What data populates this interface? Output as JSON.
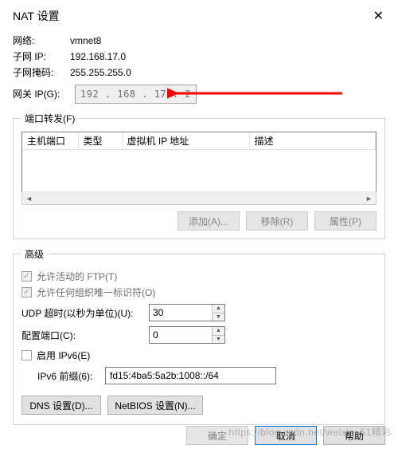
{
  "window": {
    "title": "NAT 设置"
  },
  "network": {
    "network_label": "网络:",
    "network_value": "vmnet8",
    "subnet_ip_label": "子网 IP:",
    "subnet_ip_value": "192.168.17.0",
    "subnet_mask_label": "子网掩码:",
    "subnet_mask_value": "255.255.255.0",
    "gateway_label": "网关 IP(G):",
    "gateway_value": "192 . 168 . 17  .  2"
  },
  "port_forward": {
    "legend": "端口转发(F)",
    "columns": {
      "host_port": "主机端口",
      "type": "类型",
      "vm_ip": "虚拟机 IP 地址",
      "desc": "描述"
    },
    "buttons": {
      "add": "添加(A)...",
      "remove": "移除(R)",
      "properties": "属性(P)"
    }
  },
  "advanced": {
    "legend": "高级",
    "allow_active_ftp": "允许活动的 FTP(T)",
    "allow_any_oui": "允许任何组织唯一标识符(O)",
    "udp_timeout_label": "UDP 超时(以秒为单位)(U):",
    "udp_timeout_value": "30",
    "config_port_label": "配置端口(C):",
    "config_port_value": "0",
    "enable_ipv6": "启用 IPv6(E)",
    "ipv6_prefix_label": "IPv6 前缀(6):",
    "ipv6_prefix_value": "fd15:4ba5:5a2b:1008::/64",
    "dns_settings": "DNS 设置(D)...",
    "netbios_settings": "NetBIOS 设置(N)..."
  },
  "dialog_buttons": {
    "ok": "确定",
    "cancel": "取消",
    "help": "帮助"
  },
  "watermark": "https://blog.csdn.net/weixin_51精彩"
}
